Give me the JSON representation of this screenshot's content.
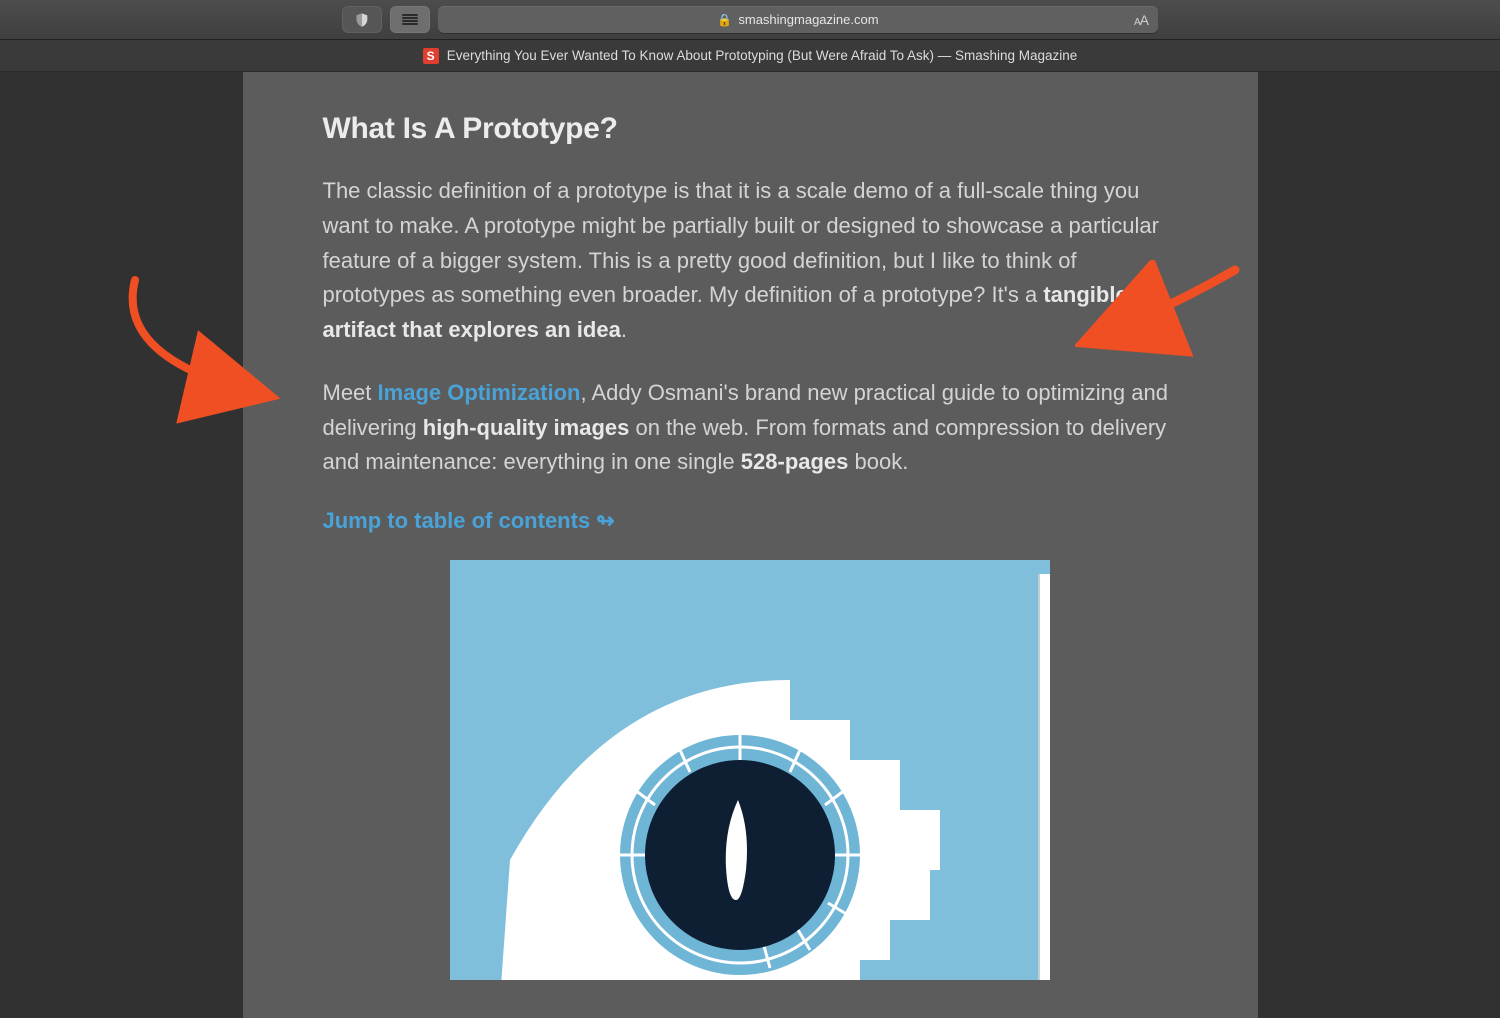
{
  "browser": {
    "domain": "smashingmagazine.com",
    "tab_title": "Everything You Ever Wanted To Know About Prototyping (But Were Afraid To Ask) — Smashing Magazine",
    "favicon_letter": "S",
    "reader_size_label": "AA"
  },
  "article": {
    "heading": "What Is A Prototype?",
    "p1_pre": "The classic definition of a prototype is that it is a scale demo of a full-scale thing you want to make. A prototype might be partially built or designed to showcase a particular feature of a bigger system. This is a pretty good definition, but I like to think of prototypes as something even broader. My definition of a prototype? It's a ",
    "p1_strong": "tangible artifact that explores an idea",
    "p1_post": ".",
    "p2_pre": "Meet ",
    "p2_link": "Image Optimization",
    "p2_mid": ", Addy Osmani's brand new practical guide to optimizing and delivering ",
    "p2_strong1": "high-quality images",
    "p2_mid2": " on the web. From formats and compression to delivery and maintenance: everything in one single ",
    "p2_strong2": "528-pages",
    "p2_post": " book.",
    "jump_link": "Jump to table of contents ↬"
  },
  "colors": {
    "accent_link": "#4aa3d8",
    "annotation_arrow": "#f04e23",
    "book_bg": "#7fbfdc",
    "pupil": "#0e1f33"
  }
}
